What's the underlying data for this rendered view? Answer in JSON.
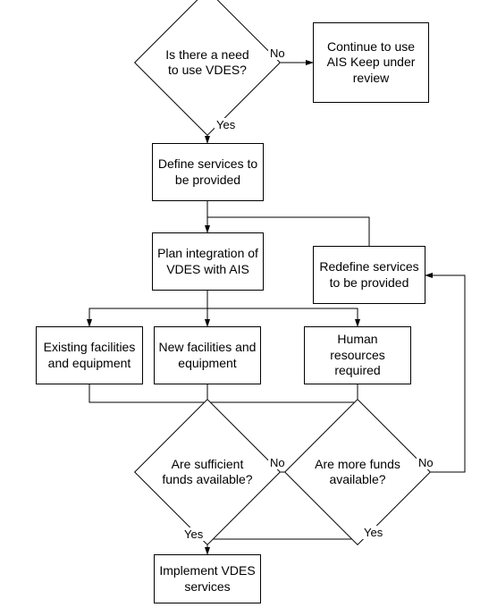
{
  "nodes": {
    "d1": "Is there a need to use VDES?",
    "b1": "Continue to use AIS Keep under review",
    "b2": "Define services to be provided",
    "b3": "Redefine services to be provided",
    "b4": "Plan integration of VDES with AIS",
    "b5": "Existing facilities and equipment",
    "b6": "New facilities and equipment",
    "b7": "Human resources required",
    "d2": "Are sufficient funds available?",
    "d3": "Are more funds available?",
    "b8": "Implement VDES services"
  },
  "labels": {
    "no1": "No",
    "yes1": "Yes",
    "no2": "No",
    "yes2": "Yes",
    "no3": "No",
    "yes3": "Yes"
  },
  "chart_data": {
    "type": "flowchart",
    "nodes": [
      {
        "id": "d1",
        "type": "decision",
        "text": "Is there a need to use VDES?"
      },
      {
        "id": "b1",
        "type": "process",
        "text": "Continue to use AIS Keep under review"
      },
      {
        "id": "b2",
        "type": "process",
        "text": "Define services to be provided"
      },
      {
        "id": "b3",
        "type": "process",
        "text": "Redefine services to be provided"
      },
      {
        "id": "b4",
        "type": "process",
        "text": "Plan integration of VDES with AIS"
      },
      {
        "id": "b5",
        "type": "process",
        "text": "Existing facilities and equipment"
      },
      {
        "id": "b6",
        "type": "process",
        "text": "New facilities and equipment"
      },
      {
        "id": "b7",
        "type": "process",
        "text": "Human resources required"
      },
      {
        "id": "d2",
        "type": "decision",
        "text": "Are sufficient funds available?"
      },
      {
        "id": "d3",
        "type": "decision",
        "text": "Are more funds available?"
      },
      {
        "id": "b8",
        "type": "process",
        "text": "Implement VDES services"
      }
    ],
    "edges": [
      {
        "from": "d1",
        "to": "b1",
        "label": "No"
      },
      {
        "from": "d1",
        "to": "b2",
        "label": "Yes"
      },
      {
        "from": "b2",
        "to": "b4"
      },
      {
        "from": "b3",
        "to": "b4"
      },
      {
        "from": "b4",
        "to": "b5"
      },
      {
        "from": "b4",
        "to": "b6"
      },
      {
        "from": "b4",
        "to": "b7"
      },
      {
        "from": "b5",
        "to": "d2"
      },
      {
        "from": "b6",
        "to": "d2"
      },
      {
        "from": "b7",
        "to": "d2"
      },
      {
        "from": "d2",
        "to": "d3",
        "label": "No"
      },
      {
        "from": "d2",
        "to": "b8",
        "label": "Yes"
      },
      {
        "from": "d3",
        "to": "b8",
        "label": "Yes"
      },
      {
        "from": "d3",
        "to": "b3",
        "label": "No"
      }
    ]
  }
}
